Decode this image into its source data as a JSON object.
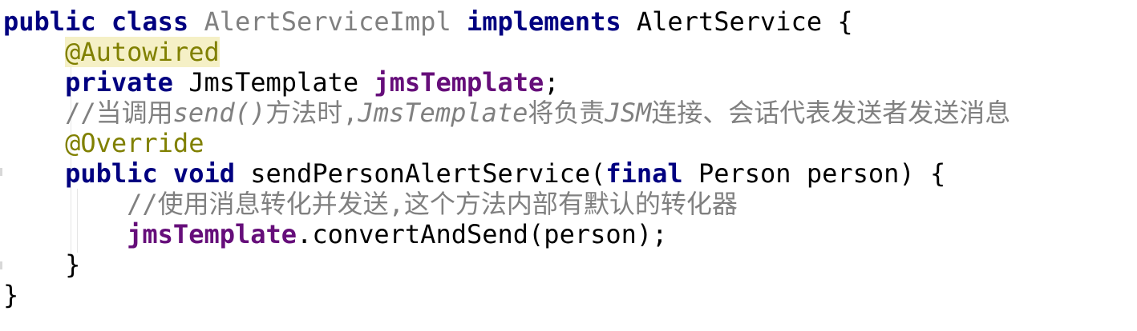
{
  "code": {
    "line1": {
      "kw1": "public",
      "kw2": "class",
      "class_name": "AlertServiceImpl",
      "kw3": "implements",
      "iface": "AlertService",
      "brace": "{"
    },
    "line2": {
      "annotation": "@Autowired"
    },
    "line3": {
      "kw": "private",
      "type": "JmsTemplate",
      "field": "jmsTemplate",
      "end": ";"
    },
    "line4": {
      "c1": "//当调用",
      "c2": "send()",
      "c3": "方法时,",
      "c4": "JmsTemplate",
      "c5": "将负责",
      "c6": "JSM",
      "c7": "连接、会话代表发送者发送消息"
    },
    "line5": {
      "annotation": "@Override"
    },
    "line6": {
      "kw1": "public",
      "kw2": "void",
      "method": "sendPersonAlertService(",
      "kw3": "final",
      "params": "Person person) {"
    },
    "line7": {
      "comment": "//使用消息转化并发送,这个方法内部有默认的转化器"
    },
    "line8": {
      "field": "jmsTemplate",
      "call": ".convertAndSend(person);"
    },
    "line9": {
      "brace": "}"
    },
    "line10": {
      "brace": "}"
    }
  },
  "colors": {
    "keyword": "#000080",
    "annotation": "#808000",
    "annotation_highlight": "#f5f0c6",
    "field": "#660e7a",
    "comment": "#808080",
    "text": "#000000"
  }
}
